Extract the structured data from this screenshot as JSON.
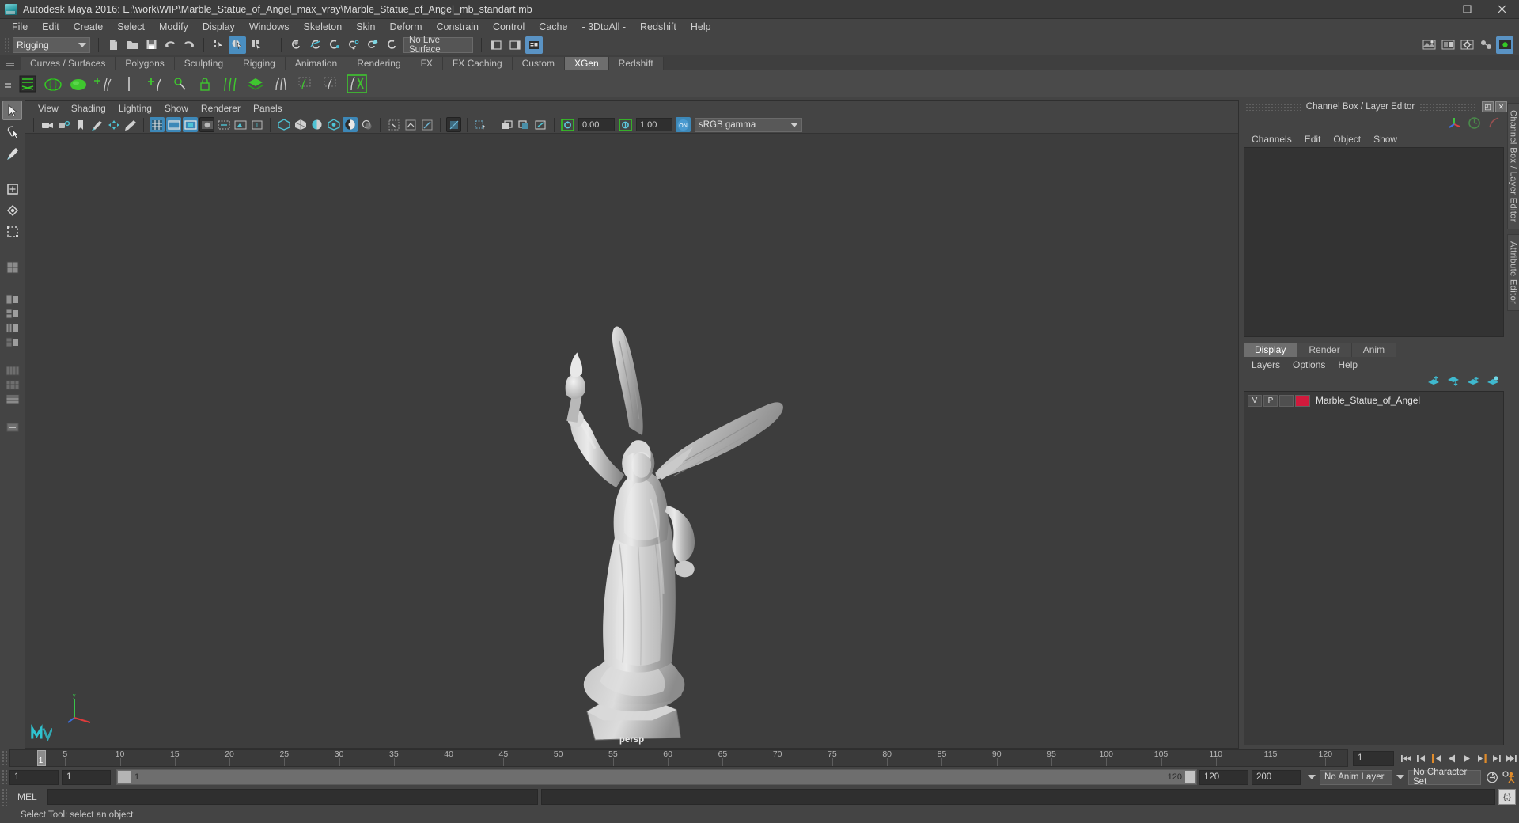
{
  "window": {
    "title": "Autodesk Maya 2016: E:\\work\\WIP\\Marble_Statue_of_Angel_max_vray\\Marble_Statue_of_Angel_mb_standart.mb",
    "app_icon": "maya-icon",
    "minimize": "−",
    "maximize": "□",
    "close": "✕"
  },
  "menubar": {
    "items": [
      {
        "label": "File"
      },
      {
        "label": "Edit"
      },
      {
        "label": "Create"
      },
      {
        "label": "Select"
      },
      {
        "label": "Modify"
      },
      {
        "label": "Display"
      },
      {
        "label": "Windows"
      },
      {
        "label": "Skeleton"
      },
      {
        "label": "Skin"
      },
      {
        "label": "Deform"
      },
      {
        "label": "Constrain"
      },
      {
        "label": "Control"
      },
      {
        "label": "Cache"
      },
      {
        "label": "- 3DtoAll -"
      },
      {
        "label": "Redshift"
      },
      {
        "label": "Help"
      }
    ]
  },
  "statusline": {
    "menuset": "Rigging",
    "live_surface": "No Live Surface",
    "icons": [
      "new-scene-icon",
      "open-scene-icon",
      "save-scene-icon",
      "undo-icon",
      "redo-icon",
      "select-by-hierarchy-icon",
      "select-by-object-icon",
      "select-by-component-icon",
      "snap-to-grid-icon",
      "snap-to-curve-icon",
      "snap-to-point-icon",
      "snap-to-projected-icon",
      "snap-to-view-plane-icon",
      "make-live-icon",
      "show-hide-editor-icon",
      "show-attribute-editor-icon",
      "show-channel-box-icon",
      "render-current-frame-icon",
      "ipr-render-icon",
      "render-settings-icon",
      "hypershade-icon",
      "open-render-view-icon"
    ]
  },
  "shelf": {
    "tabs": [
      {
        "label": "Curves / Surfaces",
        "active": false
      },
      {
        "label": "Polygons",
        "active": false
      },
      {
        "label": "Sculpting",
        "active": false
      },
      {
        "label": "Rigging",
        "active": false
      },
      {
        "label": "Animation",
        "active": false
      },
      {
        "label": "Rendering",
        "active": false
      },
      {
        "label": "FX",
        "active": false
      },
      {
        "label": "FX Caching",
        "active": false
      },
      {
        "label": "Custom",
        "active": false
      },
      {
        "label": "XGen",
        "active": true
      },
      {
        "label": "Redshift",
        "active": false
      }
    ],
    "items": [
      "xgen-editor-icon",
      "xgen-sphere-icon",
      "xgen-green-sphere-icon",
      "xgen-add-hair-icon",
      "xgen-separator-icon",
      "xgen-add-guide-icon",
      "xgen-sculpt-guide-icon",
      "xgen-lock-icon",
      "xgen-grooming-icon",
      "xgen-collection-icon",
      "xgen-clump-icon",
      "xgen-preview-icon",
      "xgen-render-icon",
      "xgen-export-icon"
    ]
  },
  "toolbox": {
    "tools": [
      {
        "name": "select-tool",
        "selected": true
      },
      {
        "name": "lasso-select-tool",
        "selected": false
      },
      {
        "name": "paint-select-tool",
        "selected": false
      },
      {
        "name": "move-tool",
        "selected": false
      },
      {
        "name": "rotate-tool",
        "selected": false
      },
      {
        "name": "scale-tool",
        "selected": false
      },
      {
        "name": "last-tool-used",
        "selected": false
      }
    ],
    "layouts": [
      "single-perspective-layout",
      "four-view-layout",
      "two-pane-stacked-layout",
      "two-pane-side-layout",
      "three-pane-layout",
      "outliner-persp-layout",
      "hypergraph-persp-layout",
      "persp-graph-layout"
    ]
  },
  "viewport_panel": {
    "menu": [
      {
        "label": "View"
      },
      {
        "label": "Shading"
      },
      {
        "label": "Lighting"
      },
      {
        "label": "Show"
      },
      {
        "label": "Renderer"
      },
      {
        "label": "Panels"
      }
    ],
    "exposure_value": "0.00",
    "gamma_value": "1.00",
    "color_space": "sRGB gamma",
    "gamma_toggle": "ON",
    "camera_label": "persp",
    "toolbar_icons": [
      "select-camera-icon",
      "camera-attributes-icon",
      "bookmark-icon",
      "image-plane-icon",
      "2d-pan-zoom-icon",
      "grease-pencil-icon",
      "grid-toggle-icon",
      "film-gate-icon",
      "resolution-gate-icon",
      "gate-mask-icon",
      "film-origin-icon",
      "exposure-icon",
      "xray-icon",
      "wireframe-shading-icon",
      "smooth-shading-icon",
      "shaded-wireframe-icon",
      "textured-icon",
      "lights-icon",
      "shadows-icon",
      "screen-space-ao-icon",
      "motion-blur-icon",
      "multisample-icon",
      "depth-peeling-icon",
      "isolate-select-icon",
      "xray-joints-icon",
      "xray-active-icon"
    ]
  },
  "channel_box": {
    "panel_title": "Channel Box / Layer Editor",
    "float_button": "◰",
    "close_button": "✕",
    "menu": [
      {
        "label": "Channels"
      },
      {
        "label": "Edit"
      },
      {
        "label": "Object"
      },
      {
        "label": "Show"
      }
    ],
    "icons": [
      "move-axis-icon",
      "anim-clock-icon",
      "curve-icon"
    ],
    "vertical_tabs": [
      {
        "label": "Channel Box / Layer Editor"
      },
      {
        "label": "Attribute Editor"
      }
    ]
  },
  "layer_editor": {
    "tabs": [
      {
        "label": "Display",
        "active": true
      },
      {
        "label": "Render",
        "active": false
      },
      {
        "label": "Anim",
        "active": false
      }
    ],
    "menu": [
      {
        "label": "Layers"
      },
      {
        "label": "Options"
      },
      {
        "label": "Help"
      }
    ],
    "buttons": [
      "move-layer-up-icon",
      "move-layer-down-icon",
      "new-layer-icon",
      "new-layer-from-selected-icon"
    ],
    "layers": [
      {
        "visibility": "V",
        "playback": "P",
        "color": "#d01a3c",
        "name": "Marble_Statue_of_Angel"
      }
    ]
  },
  "time_slider": {
    "start_tick": 1,
    "ticks": [
      5,
      10,
      15,
      20,
      25,
      30,
      35,
      40,
      45,
      50,
      55,
      60,
      65,
      70,
      75,
      80,
      85,
      90,
      95,
      100,
      105,
      110,
      115,
      120
    ],
    "current_frame_marker": "1",
    "end_label": "120",
    "current_frame_field": "1",
    "playback_buttons": [
      "go-to-start-icon",
      "step-back-key-icon",
      "step-back-frame-icon",
      "play-backwards-icon",
      "play-forwards-icon",
      "step-forward-frame-icon",
      "step-forward-key-icon",
      "go-to-end-icon"
    ]
  },
  "range_slider": {
    "anim_start": "1",
    "playback_start": "1",
    "bar_start_label": "1",
    "bar_end_label": "120",
    "playback_end": "120",
    "anim_end": "200",
    "anim_layer": "No Anim Layer",
    "character_set": "No Character Set",
    "auto_key_icon": "auto-keyframe-icon",
    "animation_prefs_icon": "animation-preferences-icon"
  },
  "command_line": {
    "label": "MEL",
    "input_value": "",
    "output_value": "",
    "script_editor_icon": "script-editor-icon"
  },
  "help_line": {
    "text": "Select Tool: select an object"
  },
  "colors": {
    "accent_blue": "#3d88b8",
    "highlight_green": "#34c924",
    "layer_red": "#d01a3c",
    "panel_bg": "#444444",
    "viewport_bg": "#3d3d3d",
    "field_bg": "#2f2f2f"
  }
}
